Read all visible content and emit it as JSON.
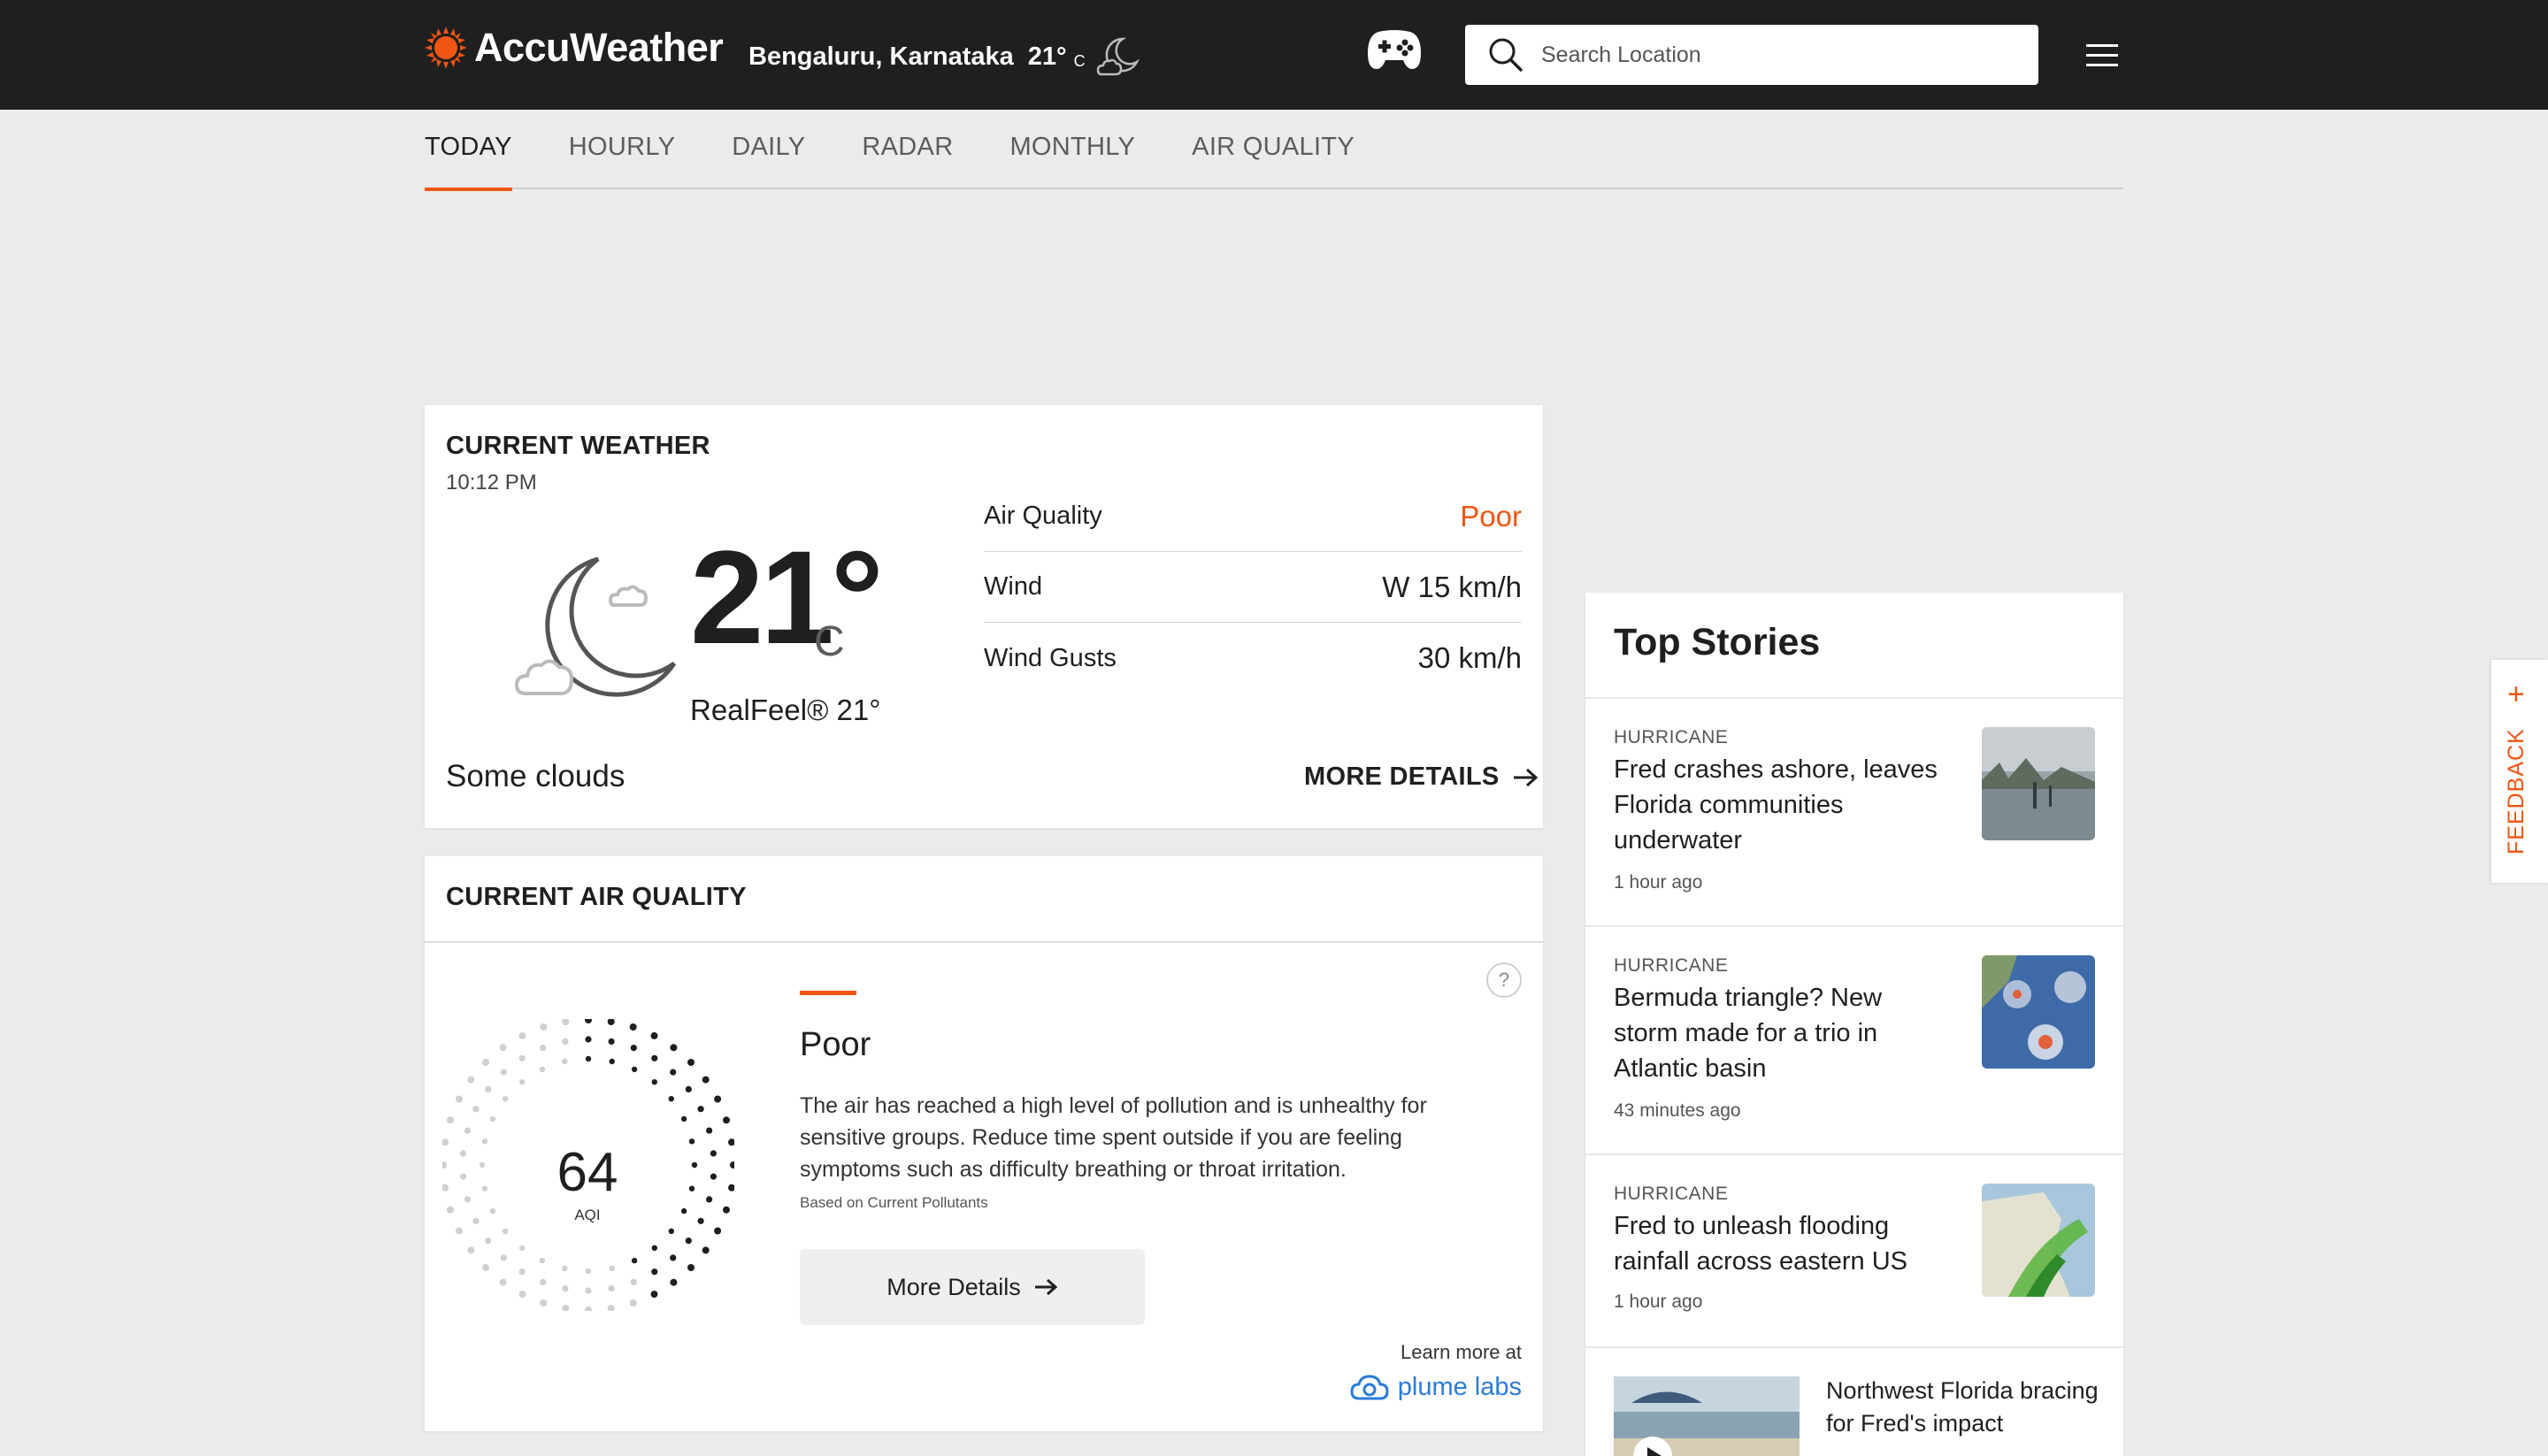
{
  "header": {
    "brand": "AccuWeather",
    "location": "Bengaluru, Karnataka",
    "temp": "21°",
    "unit": "C",
    "search_placeholder": "Search Location"
  },
  "tabs": [
    {
      "label": "TODAY",
      "active": true
    },
    {
      "label": "HOURLY"
    },
    {
      "label": "DAILY"
    },
    {
      "label": "RADAR"
    },
    {
      "label": "MONTHLY"
    },
    {
      "label": "AIR QUALITY"
    }
  ],
  "current_weather": {
    "title": "CURRENT WEATHER",
    "time": "10:12 PM",
    "temp": "21°",
    "unit": "C",
    "realfeel": "RealFeel® 21°",
    "condition": "Some clouds",
    "more_details": "MORE DETAILS",
    "details": [
      {
        "label": "Air Quality",
        "value": "Poor"
      },
      {
        "label": "Wind",
        "value": "W 15 km/h"
      },
      {
        "label": "Wind Gusts",
        "value": "30 km/h"
      }
    ]
  },
  "air_quality": {
    "title": "CURRENT AIR QUALITY",
    "aqi": "64",
    "aqi_label": "AQI",
    "category": "Poor",
    "description": "The air has reached a high level of pollution and is unhealthy for sensitive groups. Reduce time spent outside if you are feeling symptoms such as difficulty breathing or throat irritation.",
    "based_on": "Based on Current Pollutants",
    "button": "More Details",
    "help": "?",
    "learn_more": "Learn more at",
    "partner": "plume labs"
  },
  "top_stories": {
    "title": "Top Stories",
    "items": [
      {
        "category": "HURRICANE",
        "headline": "Fred crashes ashore, leaves Florida communities underwater",
        "time": "1 hour ago"
      },
      {
        "category": "HURRICANE",
        "headline": "Bermuda triangle? New storm made for a trio in Atlantic basin",
        "time": "43 minutes ago"
      },
      {
        "category": "HURRICANE",
        "headline": "Fred to unleash flooding rainfall across eastern US",
        "time": "1 hour ago"
      }
    ],
    "video_item": {
      "headline": "Northwest Florida bracing for Fred's impact"
    }
  },
  "feedback": {
    "label": "FEEDBACK",
    "plus": "+"
  },
  "colors": {
    "accent": "#f05514",
    "header_bg": "#1f1f1f",
    "page_bg": "#ebebeb",
    "link": "#2b7bd9"
  }
}
